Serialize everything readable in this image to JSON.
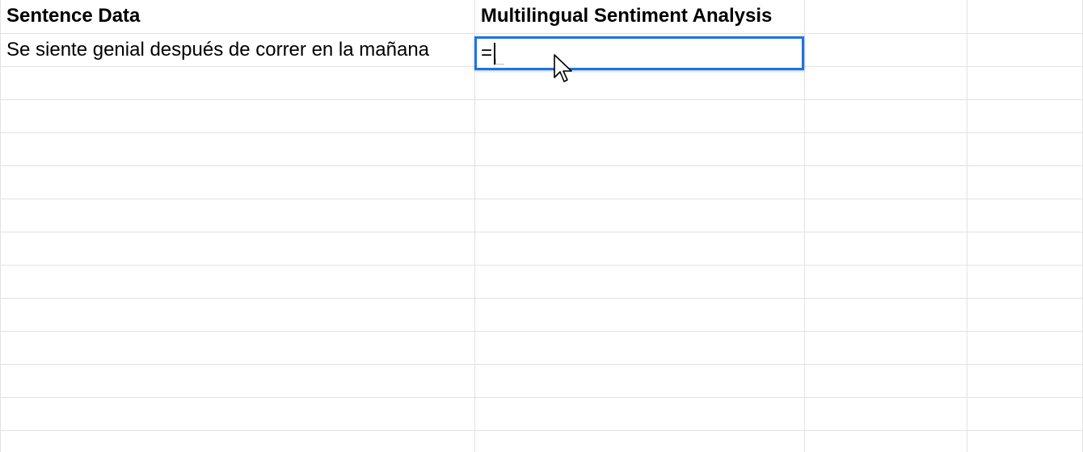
{
  "sheet": {
    "headers": {
      "col_a": "Sentence Data",
      "col_b": "Multilingual Sentiment Analysis",
      "col_c": "",
      "col_d": ""
    },
    "rows": [
      {
        "col_a": "Se siente genial después de correr en la mañana",
        "col_b": ""
      }
    ]
  },
  "active_cell": {
    "value": "=",
    "border_color": "#1a73e8"
  },
  "icons": {
    "cursor": "arrow-pointer-icon"
  }
}
